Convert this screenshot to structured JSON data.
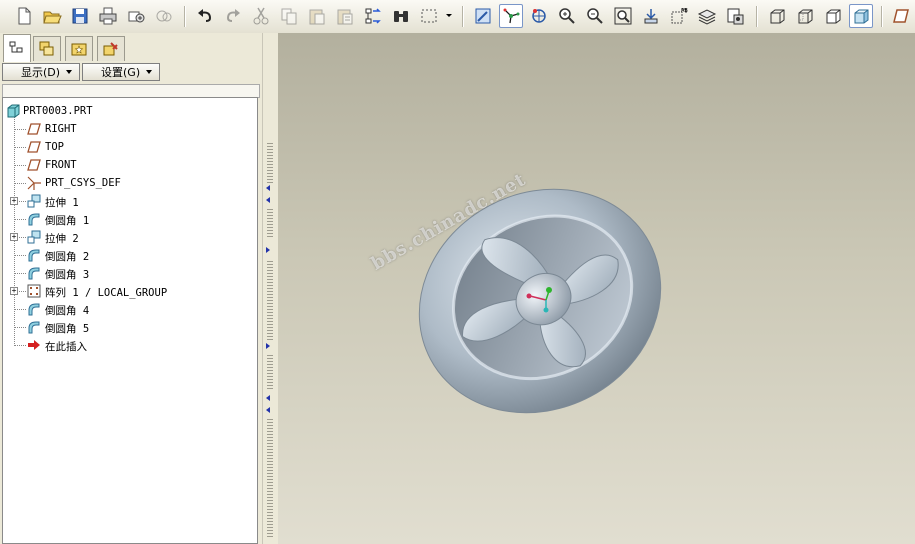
{
  "toolbar": {
    "groups": [
      [
        "new-icon",
        "open-icon",
        "save-icon",
        "print-icon",
        "send-mail-icon",
        "send-mail-attachment-icon"
      ],
      [
        "undo-icon",
        "redo-icon",
        "cut-icon",
        "copy-icon",
        "paste-icon",
        "paste-special-icon",
        "regenerate-icon",
        "find-icon",
        "select-box-icon"
      ],
      [
        "repaint-icon",
        "spin-center-icon",
        "orient-mode-icon",
        "zoom-in-icon",
        "zoom-out-icon",
        "refit-icon",
        "reorient-icon",
        "saved-views-icon",
        "layers-icon",
        "view-manager-icon"
      ],
      [
        "wireframe-icon",
        "hidden-line-icon",
        "no-hidden-icon",
        "shading-icon"
      ],
      [
        "datum-planes-icon"
      ]
    ]
  },
  "panel_tabs": [
    "model-tree-tab",
    "layer-tree-tab",
    "favorites-tab",
    "feature-tools-tab"
  ],
  "panel_buttons": {
    "show_label": "显示(D)",
    "settings_label": "设置(G)"
  },
  "model_tree": {
    "root": "PRT0003.PRT",
    "items": [
      {
        "label": "RIGHT",
        "icon": "datum-plane-icon",
        "expandable": false
      },
      {
        "label": "TOP",
        "icon": "datum-plane-icon",
        "expandable": false
      },
      {
        "label": "FRONT",
        "icon": "datum-plane-icon",
        "expandable": false
      },
      {
        "label": "PRT_CSYS_DEF",
        "icon": "coordinate-system-icon",
        "expandable": false
      },
      {
        "label": "拉伸 1",
        "icon": "extrude-icon",
        "expandable": true
      },
      {
        "label": "倒圆角 1",
        "icon": "round-icon",
        "expandable": false
      },
      {
        "label": "拉伸 2",
        "icon": "extrude-icon",
        "expandable": true
      },
      {
        "label": "倒圆角 2",
        "icon": "round-icon",
        "expandable": false
      },
      {
        "label": "倒圆角 3",
        "icon": "round-icon",
        "expandable": false
      },
      {
        "label": "阵列 1 / LOCAL_GROUP",
        "icon": "pattern-icon",
        "expandable": true
      },
      {
        "label": "倒圆角 4",
        "icon": "round-icon",
        "expandable": false
      },
      {
        "label": "倒圆角 5",
        "icon": "round-icon",
        "expandable": false
      },
      {
        "label": "在此插入",
        "icon": "insert-here-icon",
        "expandable": false
      }
    ]
  },
  "viewport": {
    "watermark": "bbs.chinadc.net",
    "model_color": "#a9b6c2"
  }
}
